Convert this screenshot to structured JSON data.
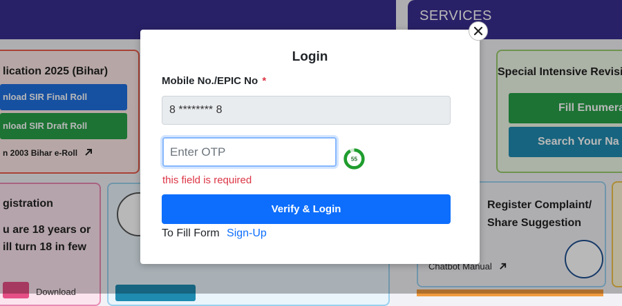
{
  "background": {
    "services_heading": "SERVICES",
    "elect_card": {
      "title": "lication 2025 (Bihar)",
      "btn_final": "nload SIR Final Roll",
      "btn_draft": "nload SIR Draft Roll",
      "link_2003": "n 2003 Bihar e-Roll"
    },
    "registration_card": {
      "title": "gistration",
      "body_line1": "u are 18 years or",
      "body_line2": "ill turn 18 in few"
    },
    "download_text": "Download",
    "sir_card": {
      "title": "Special Intensive Revisi",
      "btn_fill": "Fill Enumera",
      "btn_search": "Search Your Na"
    },
    "complaint_card": {
      "title_line1": "Register Complaint/",
      "title_line2": "Share Suggestion",
      "chatbot": "Chatbot Manual"
    }
  },
  "modal": {
    "title": "Login",
    "mobile_label": "Mobile No./EPIC No",
    "required_mark": "*",
    "mobile_value": "8 ******** 8",
    "otp_placeholder": "Enter OTP",
    "timer_value": "55",
    "timer_fraction": 0.92,
    "error": "this field is required",
    "verify_label": "Verify & Login",
    "fill_form_text": "To Fill Form",
    "signup_link": "Sign-Up"
  },
  "colors": {
    "primary": "#0d6efd",
    "error": "#dc3545",
    "banner": "#3a2e8f",
    "timer_green": "#1f9d2e"
  }
}
